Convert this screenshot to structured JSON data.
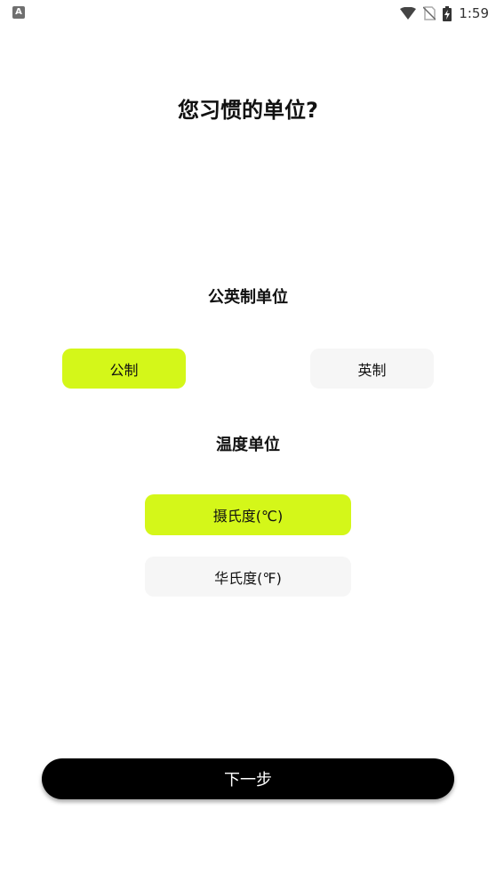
{
  "status_bar": {
    "left_icon": "A",
    "time": "1:59",
    "icons": [
      "wifi-icon",
      "no-sim-icon",
      "battery-charging-icon"
    ]
  },
  "title": "您习惯的单位?",
  "system_section": {
    "title": "公英制单位",
    "options": [
      {
        "label": "公制",
        "selected": true
      },
      {
        "label": "英制",
        "selected": false
      }
    ]
  },
  "temperature_section": {
    "title": "温度单位",
    "options": [
      {
        "label": "摄氏度(℃)",
        "selected": true
      },
      {
        "label": "华氏度(℉)",
        "selected": false
      }
    ]
  },
  "next_button": {
    "label": "下一步"
  },
  "colors": {
    "accent": "#d4f719",
    "unselected_bg": "#f6f6f6",
    "button_bg": "#000000"
  }
}
